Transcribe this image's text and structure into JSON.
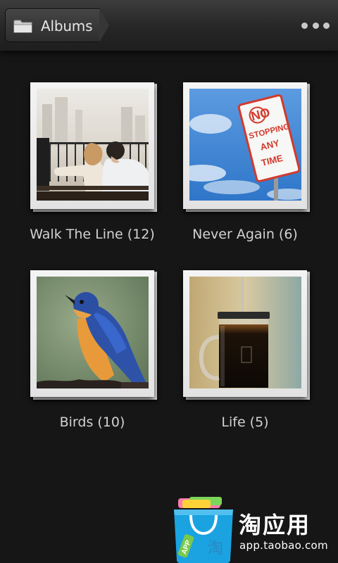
{
  "action_bar": {
    "title": "Albums",
    "folder_icon": "folder-icon",
    "overflow_icon": "more-options-icon"
  },
  "albums": [
    {
      "label": "Walk The Line (12)",
      "thumbnail": "couple-on-bench"
    },
    {
      "label": "Never Again (6)",
      "thumbnail": "no-stopping-sign"
    },
    {
      "label": "Birds (10)",
      "thumbnail": "blue-bird"
    },
    {
      "label": "Life (5)",
      "thumbnail": "french-press"
    }
  ],
  "watermark": {
    "brand_cn": "淘应用",
    "url": "app.taobao.com",
    "bag_badge": "APP",
    "bag_char": "淘"
  },
  "colors": {
    "background": "#161616",
    "action_bar": "#2a2a2a",
    "label_text": "#d2d2d2",
    "watermark_blue": "#1aa3e0"
  }
}
